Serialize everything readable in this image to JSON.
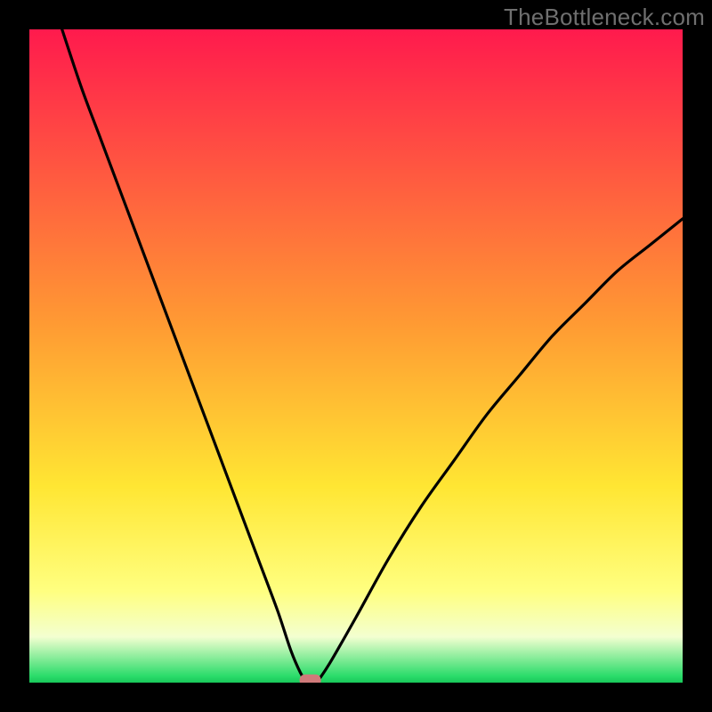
{
  "watermark": "TheBottleneck.com",
  "colors": {
    "frame": "#000000",
    "grad_top": "#ff1a4d",
    "grad_mid1": "#ff7a33",
    "grad_mid2": "#ffd633",
    "grad_low": "#ffff80",
    "grad_pale": "#f7ffcc",
    "grad_green": "#2bdc6a",
    "curve": "#000000",
    "marker": "#d07a7a"
  },
  "chart_data": {
    "type": "line",
    "title": "",
    "xlabel": "",
    "ylabel": "",
    "xlim": [
      0,
      100
    ],
    "ylim": [
      0,
      100
    ],
    "series": [
      {
        "name": "left-curve",
        "x": [
          5,
          8,
          11,
          14,
          17,
          20,
          23,
          26,
          29,
          32,
          35,
          38,
          40,
          41.5,
          42.5
        ],
        "values": [
          100,
          91,
          83,
          75,
          67,
          59,
          51,
          43,
          35,
          27,
          19,
          11,
          5,
          1.5,
          0
        ]
      },
      {
        "name": "right-curve",
        "x": [
          44,
          46,
          50,
          55,
          60,
          65,
          70,
          75,
          80,
          85,
          90,
          95,
          100
        ],
        "values": [
          0,
          3,
          10,
          19,
          27,
          34,
          41,
          47,
          53,
          58,
          63,
          67,
          71
        ]
      }
    ],
    "marker": {
      "x": 43,
      "y": 0.3
    },
    "gradient_stops": [
      {
        "pct": 0,
        "color": "#ff1a4d"
      },
      {
        "pct": 45,
        "color": "#ff9a33"
      },
      {
        "pct": 70,
        "color": "#ffe633"
      },
      {
        "pct": 86,
        "color": "#ffff80"
      },
      {
        "pct": 93,
        "color": "#f3ffd0"
      },
      {
        "pct": 99,
        "color": "#2bdc6a"
      },
      {
        "pct": 100,
        "color": "#19c85a"
      }
    ]
  }
}
